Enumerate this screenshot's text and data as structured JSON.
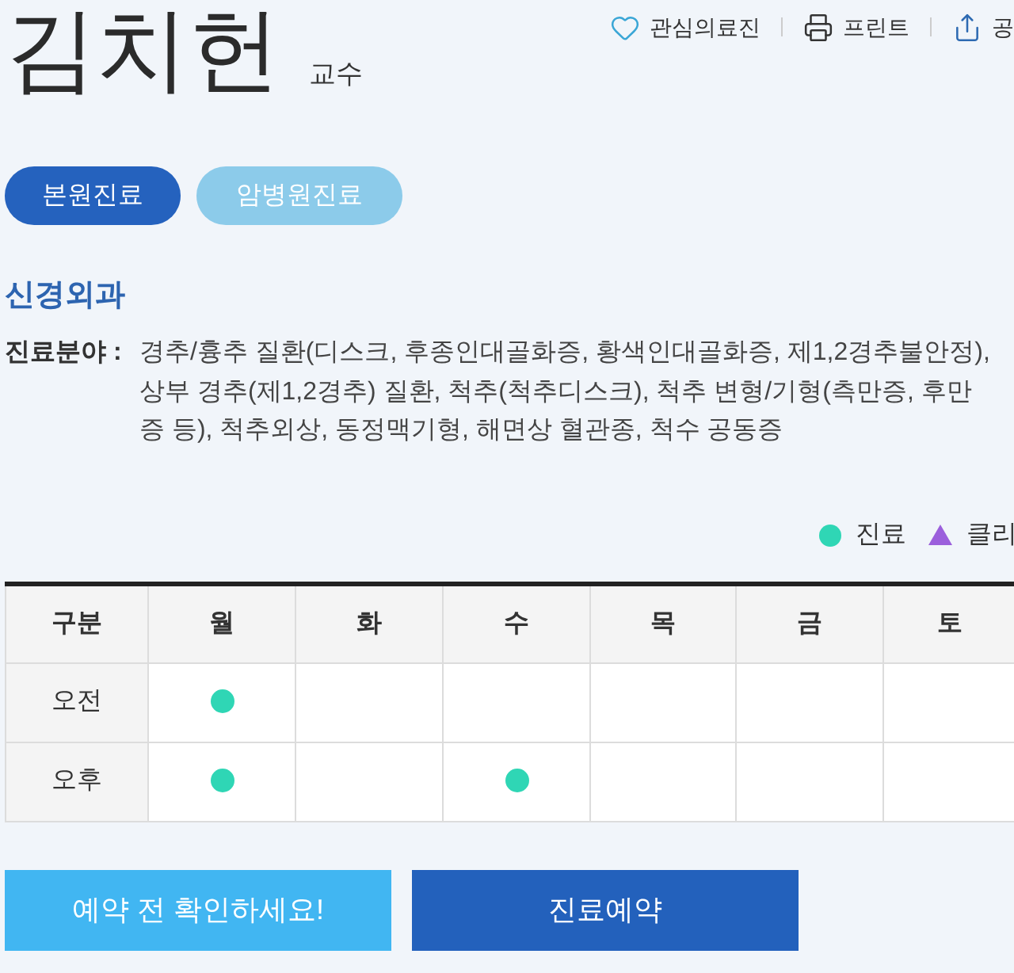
{
  "header": {
    "name": "김치헌",
    "title": "교수",
    "actions": [
      {
        "kind": "heart",
        "label": "관심의료진"
      },
      {
        "kind": "print",
        "label": "프린트"
      },
      {
        "kind": "share",
        "label": "공"
      }
    ]
  },
  "tabs": [
    {
      "label": "본원진료",
      "selected": true
    },
    {
      "label": "암병원진료",
      "selected": false
    }
  ],
  "department": "신경외과",
  "specialty": {
    "label": "진료분야 :",
    "text": "경추/흉추 질환(디스크, 후종인대골화증, 황색인대골화증, 제1,2경추불안정), 상부 경추(제1,2경추) 질환, 척추(척추디스크), 척추 변형/기형(측만증, 후만증 등), 척추외상, 동정맥기형, 해면상 혈관종, 척수 공동증"
  },
  "legend": [
    {
      "kind": "dot",
      "label": "진료",
      "color": "#2fd6b5"
    },
    {
      "kind": "triangle",
      "label": "클리",
      "color": "#9b5fdc"
    }
  ],
  "schedule": {
    "columns": [
      "구분",
      "월",
      "화",
      "수",
      "목",
      "금",
      "토"
    ],
    "rows": [
      {
        "label": "오전",
        "cells": [
          {
            "clinic": true
          },
          {
            "clinic": false
          },
          {
            "clinic": false
          },
          {
            "clinic": false
          },
          {
            "clinic": false
          },
          {
            "clinic": false
          }
        ]
      },
      {
        "label": "오후",
        "cells": [
          {
            "clinic": true
          },
          {
            "clinic": false
          },
          {
            "clinic": true
          },
          {
            "clinic": false
          },
          {
            "clinic": false
          },
          {
            "clinic": false
          }
        ]
      }
    ]
  },
  "buttons": [
    {
      "kind": "secondary",
      "label": "예약 전 확인하세요!"
    },
    {
      "kind": "primary",
      "label": "진료예약"
    }
  ]
}
